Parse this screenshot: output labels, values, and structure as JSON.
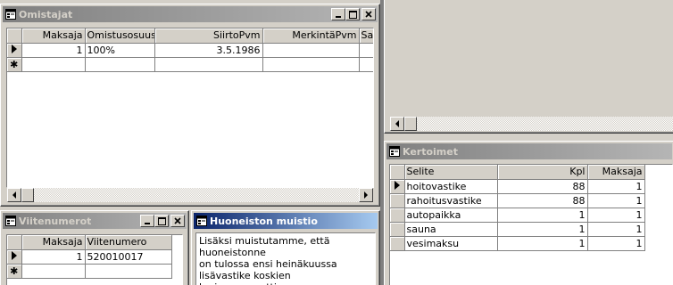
{
  "omistajat": {
    "title": "Omistajat",
    "columns": [
      "Maksaja",
      "Omistusosuus",
      "SiirtoPvm",
      "MerkintäPvm",
      "Saa"
    ],
    "rows": [
      {
        "maksaja": "1",
        "osuus": "100%",
        "siirto": "3.5.1986",
        "merkinta": "",
        "saa": ""
      }
    ],
    "new_row_marker": "✱"
  },
  "viitenumerot": {
    "title": "Viitenumerot",
    "columns": [
      "Maksaja",
      "Viitenumero"
    ],
    "rows": [
      {
        "maksaja": "1",
        "viite": "520010017"
      }
    ],
    "new_row_marker": "✱"
  },
  "muistio": {
    "title": "Huoneiston muistio",
    "text_lines": [
      "Lisäksi muistutamme, että huoneistonne",
      "on tulossa ensi heinäkuussa",
      "lisävastike koskien korjausremonttia."
    ]
  },
  "kertoimet": {
    "title": "Kertoimet",
    "columns": [
      "Selite",
      "Kpl",
      "Maksaja"
    ],
    "rows": [
      {
        "selite": "hoitovastike",
        "kpl": "88",
        "maksaja": "1"
      },
      {
        "selite": "rahoitusvastike",
        "kpl": "88",
        "maksaja": "1"
      },
      {
        "selite": "autopaikka",
        "kpl": "1",
        "maksaja": "1"
      },
      {
        "selite": "sauna",
        "kpl": "1",
        "maksaja": "1"
      },
      {
        "selite": "vesimaksu",
        "kpl": "1",
        "maksaja": "1"
      }
    ]
  },
  "colors": {
    "active_title": "#0a246a",
    "inactive_title": "#808080",
    "face": "#d4d0c8"
  }
}
